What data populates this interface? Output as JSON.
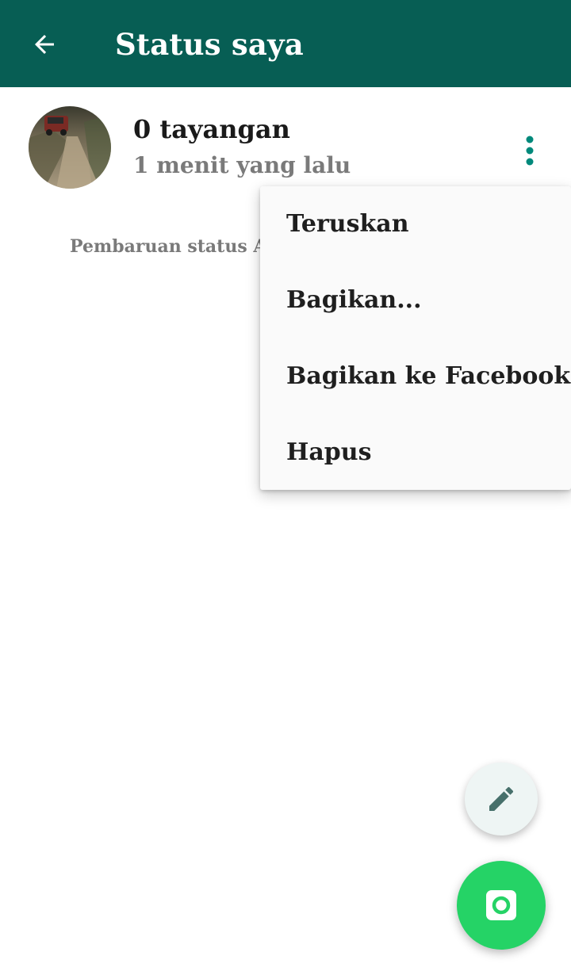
{
  "header": {
    "title": "Status saya",
    "back_icon": "arrow-left-icon",
    "background": "#075e54"
  },
  "status": {
    "views": "0 tayangan",
    "time": "1 menit yang lalu",
    "thumbnail": "status-thumbnail",
    "more_icon": "more-vertical-icon"
  },
  "hint_text": "Pembaruan status Anda",
  "menu": {
    "items": [
      "Teruskan",
      "Bagikan...",
      "Bagikan ke Facebook",
      "Hapus"
    ]
  },
  "fab": {
    "edit_icon": "pencil-icon",
    "camera_icon": "camera-icon",
    "accent": "#25d366"
  }
}
